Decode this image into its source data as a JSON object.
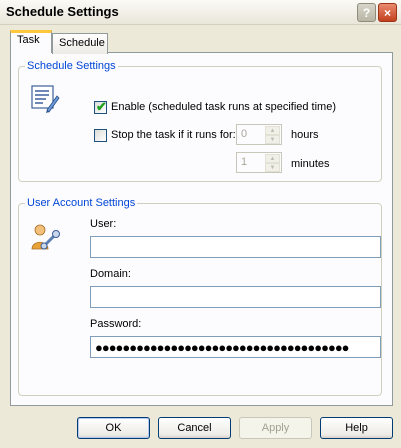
{
  "window": {
    "title": "Schedule Settings",
    "help_button": "?",
    "close_button": "×"
  },
  "tabs": [
    {
      "label": "Task",
      "selected": true
    },
    {
      "label": "Schedule",
      "selected": false
    }
  ],
  "schedule_settings": {
    "legend": "Schedule Settings",
    "icon": "schedule-settings-icon",
    "enable_label": "Enable (scheduled task runs at specified time)",
    "enable_checked": true,
    "stop_label": "Stop the task if it runs for:",
    "stop_checked": false,
    "hours_value": "0",
    "hours_unit": "hours",
    "minutes_value": "1",
    "minutes_unit": "minutes"
  },
  "user_account": {
    "legend": "User Account Settings",
    "icon": "user-account-icon",
    "user_label": "User:",
    "user_value": "",
    "domain_label": "Domain:",
    "domain_value": "",
    "password_label": "Password:",
    "password_value": "●●●●●●●●●●●●●●●●●●●●●●●●●●●●●●●●●●●●●"
  },
  "buttons": {
    "ok": "OK",
    "cancel": "Cancel",
    "apply": "Apply",
    "help": "Help"
  }
}
